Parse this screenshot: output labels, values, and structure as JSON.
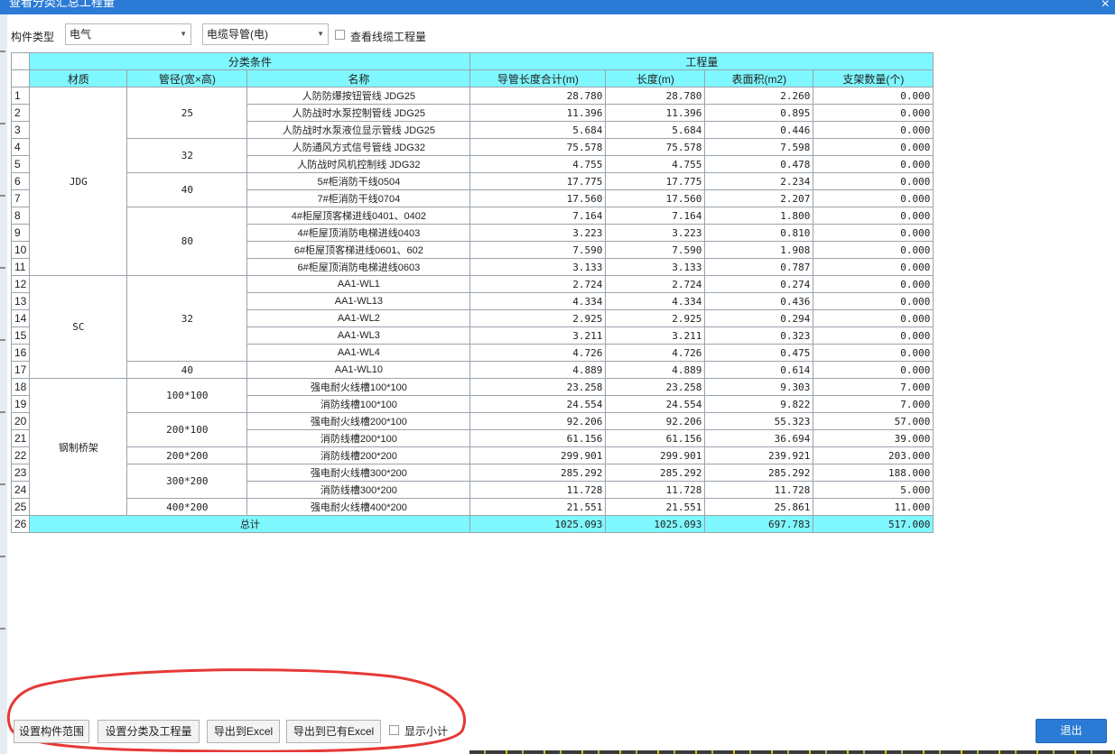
{
  "window": {
    "title": "查看分类汇总工程量",
    "close_glyph": "×"
  },
  "filters": {
    "type_label": "构件类型",
    "type_value": "电气",
    "subtype_value": "电缆导管(电)",
    "cable_checkbox_label": "查看线缆工程量",
    "cable_checked": false
  },
  "table": {
    "group_headers": {
      "classification": "分类条件",
      "quantity": "工程量"
    },
    "columns": [
      "材质",
      "管径(宽×高)",
      "名称",
      "导管长度合计(m)",
      "长度(m)",
      "表面积(m2)",
      "支架数量(个)"
    ],
    "rows": [
      {
        "no": "1",
        "material": "JDG",
        "size": "25",
        "name": "人防防爆按钮管线 JDG25",
        "conduit": "28.780",
        "length": "28.780",
        "area": "2.260",
        "brackets": "0.000"
      },
      {
        "no": "2",
        "material": "JDG",
        "size": "25",
        "name": "人防战时水泵控制管线 JDG25",
        "conduit": "11.396",
        "length": "11.396",
        "area": "0.895",
        "brackets": "0.000"
      },
      {
        "no": "3",
        "material": "JDG",
        "size": "25",
        "name": "人防战时水泵液位显示管线 JDG25",
        "conduit": "5.684",
        "length": "5.684",
        "area": "0.446",
        "brackets": "0.000"
      },
      {
        "no": "4",
        "material": "JDG",
        "size": "32",
        "name": "人防通风方式信号管线 JDG32",
        "conduit": "75.578",
        "length": "75.578",
        "area": "7.598",
        "brackets": "0.000"
      },
      {
        "no": "5",
        "material": "JDG",
        "size": "32",
        "name": "人防战时风机控制线 JDG32",
        "conduit": "4.755",
        "length": "4.755",
        "area": "0.478",
        "brackets": "0.000"
      },
      {
        "no": "6",
        "material": "JDG",
        "size": "40",
        "name": "5#柜消防干线0504",
        "conduit": "17.775",
        "length": "17.775",
        "area": "2.234",
        "brackets": "0.000"
      },
      {
        "no": "7",
        "material": "JDG",
        "size": "40",
        "name": "7#柜消防干线0704",
        "conduit": "17.560",
        "length": "17.560",
        "area": "2.207",
        "brackets": "0.000"
      },
      {
        "no": "8",
        "material": "JDG",
        "size": "80",
        "name": "4#柜屋顶客梯进线0401、0402",
        "conduit": "7.164",
        "length": "7.164",
        "area": "1.800",
        "brackets": "0.000"
      },
      {
        "no": "9",
        "material": "JDG",
        "size": "80",
        "name": "4#柜屋顶消防电梯进线0403",
        "conduit": "3.223",
        "length": "3.223",
        "area": "0.810",
        "brackets": "0.000"
      },
      {
        "no": "10",
        "material": "JDG",
        "size": "80",
        "name": "6#柜屋顶客梯进线0601、602",
        "conduit": "7.590",
        "length": "7.590",
        "area": "1.908",
        "brackets": "0.000"
      },
      {
        "no": "11",
        "material": "JDG",
        "size": "80",
        "name": "6#柜屋顶消防电梯进线0603",
        "conduit": "3.133",
        "length": "3.133",
        "area": "0.787",
        "brackets": "0.000"
      },
      {
        "no": "12",
        "material": "SC",
        "size": "32",
        "name": "AA1-WL1",
        "conduit": "2.724",
        "length": "2.724",
        "area": "0.274",
        "brackets": "0.000"
      },
      {
        "no": "13",
        "material": "SC",
        "size": "32",
        "name": "AA1-WL13",
        "conduit": "4.334",
        "length": "4.334",
        "area": "0.436",
        "brackets": "0.000"
      },
      {
        "no": "14",
        "material": "SC",
        "size": "32",
        "name": "AA1-WL2",
        "conduit": "2.925",
        "length": "2.925",
        "area": "0.294",
        "brackets": "0.000"
      },
      {
        "no": "15",
        "material": "SC",
        "size": "32",
        "name": "AA1-WL3",
        "conduit": "3.211",
        "length": "3.211",
        "area": "0.323",
        "brackets": "0.000"
      },
      {
        "no": "16",
        "material": "SC",
        "size": "32",
        "name": "AA1-WL4",
        "conduit": "4.726",
        "length": "4.726",
        "area": "0.475",
        "brackets": "0.000"
      },
      {
        "no": "17",
        "material": "SC",
        "size": "40",
        "name": "AA1-WL10",
        "conduit": "4.889",
        "length": "4.889",
        "area": "0.614",
        "brackets": "0.000"
      },
      {
        "no": "18",
        "material": "钢制桥架",
        "size": "100*100",
        "name": "强电耐火线槽100*100",
        "conduit": "23.258",
        "length": "23.258",
        "area": "9.303",
        "brackets": "7.000"
      },
      {
        "no": "19",
        "material": "钢制桥架",
        "size": "100*100",
        "name": "消防线槽100*100",
        "conduit": "24.554",
        "length": "24.554",
        "area": "9.822",
        "brackets": "7.000"
      },
      {
        "no": "20",
        "material": "钢制桥架",
        "size": "200*100",
        "name": "强电耐火线槽200*100",
        "conduit": "92.206",
        "length": "92.206",
        "area": "55.323",
        "brackets": "57.000"
      },
      {
        "no": "21",
        "material": "钢制桥架",
        "size": "200*100",
        "name": "消防线槽200*100",
        "conduit": "61.156",
        "length": "61.156",
        "area": "36.694",
        "brackets": "39.000"
      },
      {
        "no": "22",
        "material": "钢制桥架",
        "size": "200*200",
        "name": "消防线槽200*200",
        "conduit": "299.901",
        "length": "299.901",
        "area": "239.921",
        "brackets": "203.000"
      },
      {
        "no": "23",
        "material": "钢制桥架",
        "size": "300*200",
        "name": "强电耐火线槽300*200",
        "conduit": "285.292",
        "length": "285.292",
        "area": "285.292",
        "brackets": "188.000"
      },
      {
        "no": "24",
        "material": "钢制桥架",
        "size": "300*200",
        "name": "消防线槽300*200",
        "conduit": "11.728",
        "length": "11.728",
        "area": "11.728",
        "brackets": "5.000"
      },
      {
        "no": "25",
        "material": "钢制桥架",
        "size": "400*200",
        "name": "强电耐火线槽400*200",
        "conduit": "21.551",
        "length": "21.551",
        "area": "25.861",
        "brackets": "11.000"
      }
    ],
    "total": {
      "no": "26",
      "label": "总计",
      "conduit": "1025.093",
      "length": "1025.093",
      "area": "697.783",
      "brackets": "517.000"
    }
  },
  "footer": {
    "set_range_button": "设置构件范围",
    "set_classification_button": "设置分类及工程量",
    "export_excel_button": "导出到Excel",
    "export_existing_excel_button": "导出到已有Excel",
    "subtotal_checkbox_label": "显示小计",
    "subtotal_checked": false,
    "exit_button": "退出"
  },
  "colors": {
    "titlebar": "#2b7bd6",
    "header_cyan": "#7ff7ff",
    "annotation_red": "#e53935",
    "exit_button": "#2b7bd6"
  }
}
